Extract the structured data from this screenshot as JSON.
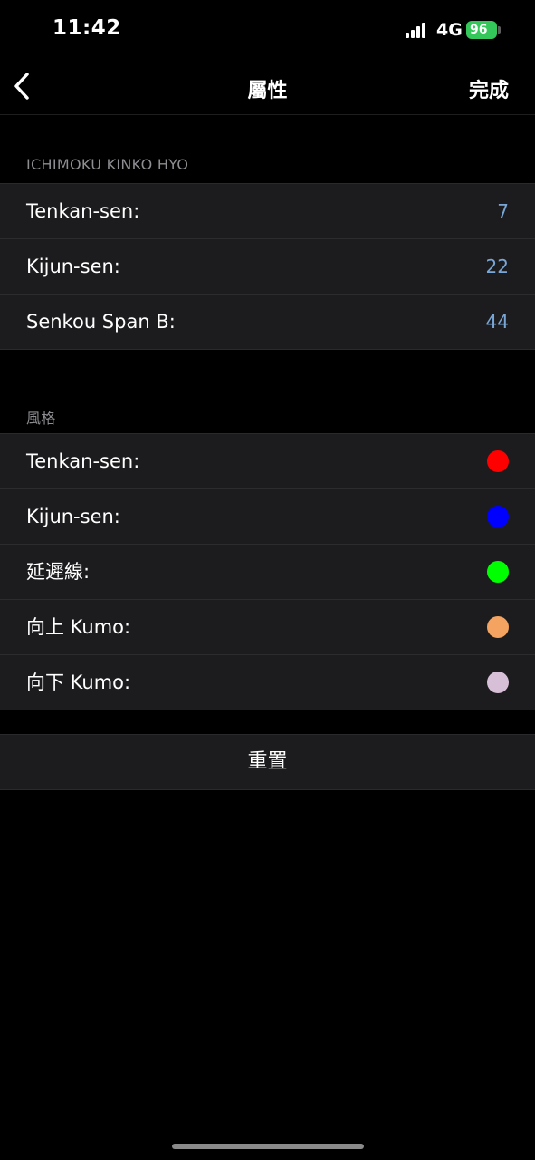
{
  "status_bar": {
    "time": "11:42",
    "network": "4G",
    "battery": "96"
  },
  "nav": {
    "back_icon": "chevron-left-icon",
    "title": "屬性",
    "done_label": "完成"
  },
  "parameters_section": {
    "header": "ICHIMOKU KINKO HYO",
    "rows": [
      {
        "label": "Tenkan-sen:",
        "value": "7"
      },
      {
        "label": "Kijun-sen:",
        "value": "22"
      },
      {
        "label": "Senkou Span B:",
        "value": "44"
      }
    ]
  },
  "style_section": {
    "header": "風格",
    "rows": [
      {
        "label": "Tenkan-sen:",
        "color": "#ff0000"
      },
      {
        "label": "Kijun-sen:",
        "color": "#0000ff"
      },
      {
        "label": "延遲線:",
        "color": "#00ff00"
      },
      {
        "label": "向上 Kumo:",
        "color": "#f4a460"
      },
      {
        "label": "向下 Kumo:",
        "color": "#d8bfd8"
      }
    ]
  },
  "reset_label": "重置"
}
